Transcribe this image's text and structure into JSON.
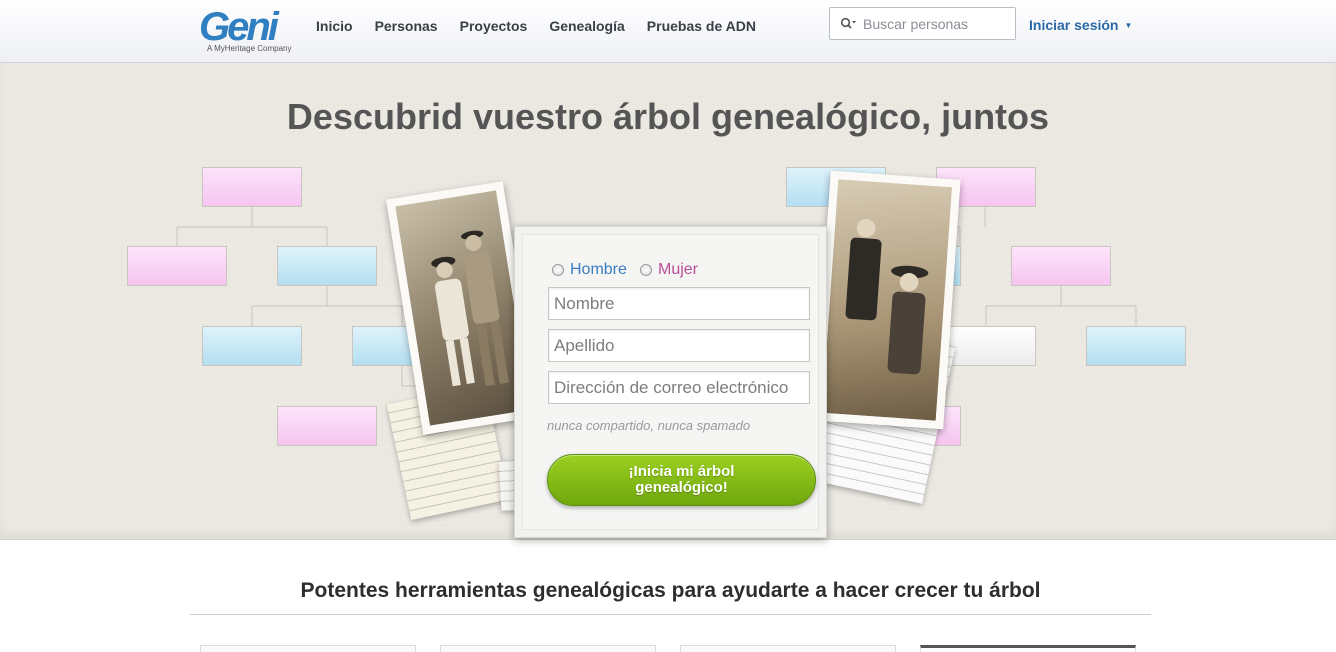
{
  "header": {
    "logo_text": "Geni",
    "logo_tagline": "A MyHeritage Company",
    "nav": [
      "Inicio",
      "Personas",
      "Proyectos",
      "Genealogía",
      "Pruebas de ADN"
    ],
    "search": {
      "placeholder": "Buscar personas",
      "value": ""
    },
    "login_label": "Iniciar sesión"
  },
  "hero": {
    "title": "Descubrid vuestro árbol genealógico, juntos"
  },
  "signup_form": {
    "gender_male": "Hombre",
    "gender_female": "Mujer",
    "first_name_placeholder": "Nombre",
    "last_name_placeholder": "Apellido",
    "email_placeholder": "Dirección de correo electrónico",
    "privacy_note": "nunca compartido, nunca spamado",
    "submit_label": "¡Inicia mi árbol genealógico!"
  },
  "features": {
    "title": "Potentes herramientas genealógicas para ayudarte a hacer crecer tu árbol"
  },
  "colors": {
    "brand_blue": "#2f7fc1",
    "male_blue": "#3a7ec1",
    "female_pink": "#b84e95",
    "cta_green": "#86bd17"
  }
}
